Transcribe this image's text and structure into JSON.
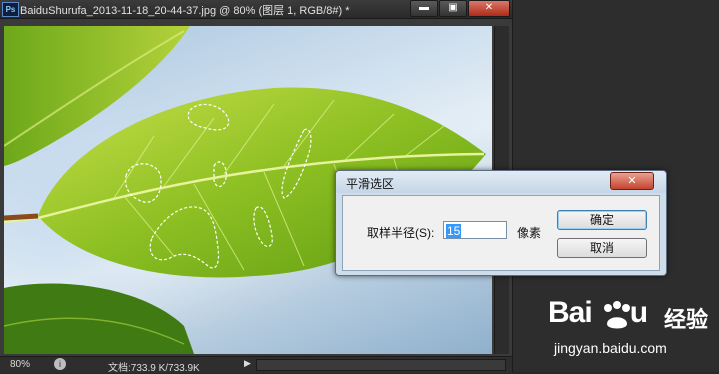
{
  "document_window": {
    "app_badge": "Ps",
    "title": "BaiduShurufa_2013-11-18_20-44-37.jpg @ 80% (图层 1, RGB/8#) *",
    "buttons": {
      "minimize": "▬",
      "maximize": "▣",
      "close": "✕"
    }
  },
  "statusbar": {
    "zoom": "80%",
    "doc_info": "文档:733.9 K/733.9K",
    "arrow": "▶"
  },
  "dialog": {
    "title": "平滑选区",
    "close_glyph": "✕",
    "radius_label": "取样半径(S):",
    "radius_value": "15",
    "unit": "像素",
    "ok_label": "确定",
    "cancel_label": "取消"
  },
  "watermark": {
    "logo_left": "Bai",
    "logo_right": "u",
    "logo_cn": "经验",
    "url": "jingyan.baidu.com"
  },
  "colors": {
    "leaf_light": "#b8d63c",
    "leaf_dark": "#4f8a10",
    "selection": "#ffffff"
  }
}
